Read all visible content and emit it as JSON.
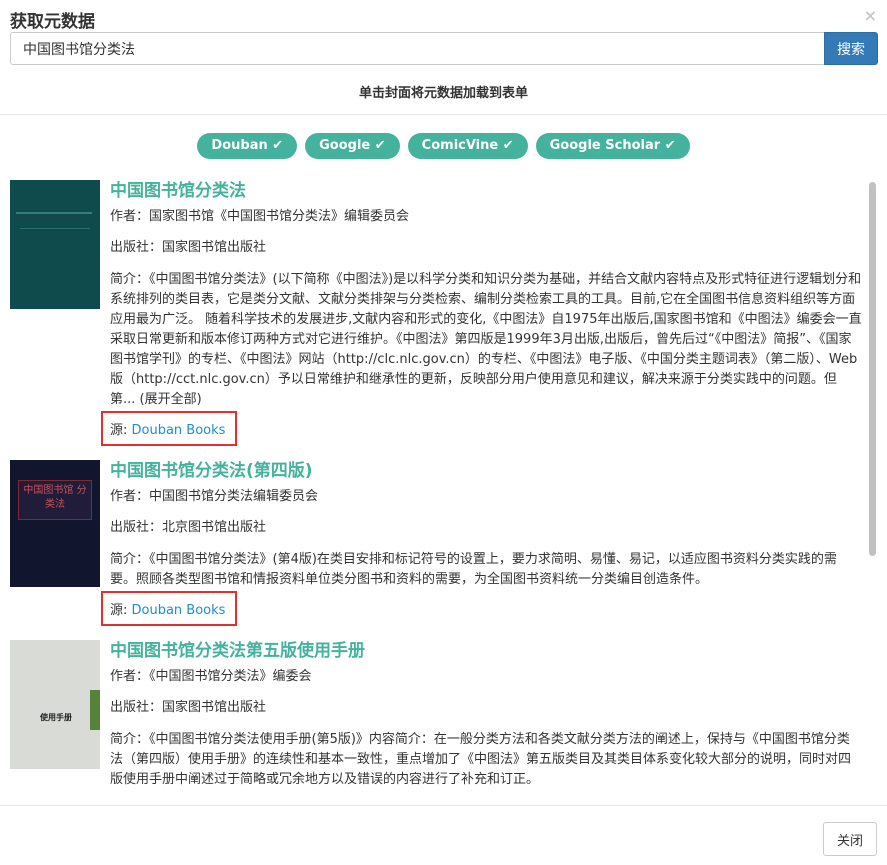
{
  "dialog": {
    "title": "获取元数据",
    "close_glyph": "×"
  },
  "search": {
    "value": "中国图书馆分类法",
    "button": "搜索"
  },
  "hint": "单击封面将元数据加载到表单",
  "sources": [
    {
      "label": "Douban ✔"
    },
    {
      "label": "Google ✔"
    },
    {
      "label": "ComicVine ✔"
    },
    {
      "label": "Google Scholar ✔"
    }
  ],
  "results": [
    {
      "title": "中国图书馆分类法",
      "author": "作者：国家图书馆《中国图书馆分类法》编辑委员会",
      "publisher": "出版社：国家图书馆出版社",
      "summary": "简介：《中国图书馆分类法》(以下简称《中图法》)是以科学分类和知识分类为基础，并结合文献内容特点及形式特征进行逻辑划分和系统排列的类目表，它是类分文献、文献分类排架与分类检索、编制分类检索工具的工具。目前,它在全国图书信息资料组织等方面应用最为广泛。 随着科学技术的发展进步,文献内容和形式的变化,《中图法》自1975年出版后,国家图书馆和《中图法》编委会一直采取日常更新和版本修订两种方式对它进行维护。《中图法》第四版是1999年3月出版,出版后，曾先后过“《中图法》简报”、《国家图书馆学刊》的专栏、《中图法》网站（http://clc.nlc.gov.cn）的专栏、《中图法》电子版、《中国分类主题词表》（第二版）、Web版（http://cct.nlc.gov.cn）予以日常维护和继承性的更新，反映部分用户使用意见和建议，解决来源于分类实践中的问题。但第...",
      "expand": "(展开全部)",
      "source_prefix": "源: ",
      "source_link": "Douban Books"
    },
    {
      "title": "中国图书馆分类法(第四版)",
      "author": "作者：中国图书馆分类法编辑委员会",
      "publisher": "出版社：北京图书馆出版社",
      "summary": "简介：《中国图书馆分类法》(第4版)在类目安排和标记符号的设置上，要力求简明、易懂、易记，以适应图书资料分类实践的需要。照顾各类型图书馆和情报资料单位类分图书和资料的需要，为全国图书资料统一分类编目创造条件。",
      "source_prefix": "源: ",
      "source_link": "Douban Books",
      "cover_text": "中国图书馆 分类法"
    },
    {
      "title": "中国图书馆分类法第五版使用手册",
      "author": "作者：《中国图书馆分类法》编委会",
      "publisher": "出版社：国家图书馆出版社",
      "summary": "简介：《中国图书馆分类法使用手册(第5版)》内容简介：在一般分类方法和各类文献分类方法的阐述上，保持与《中国图书馆分类法（第四版）使用手册》的连续性和基本一致性，重点增加了《中图法》第五版类目及其类目体系变化较大部分的说明，同时对四版使用手册中阐述过于简略或冗余地方以及错误的内容进行了补充和订正。",
      "cover_text": "使用手册"
    }
  ],
  "footer": {
    "close_button": "关闭"
  }
}
